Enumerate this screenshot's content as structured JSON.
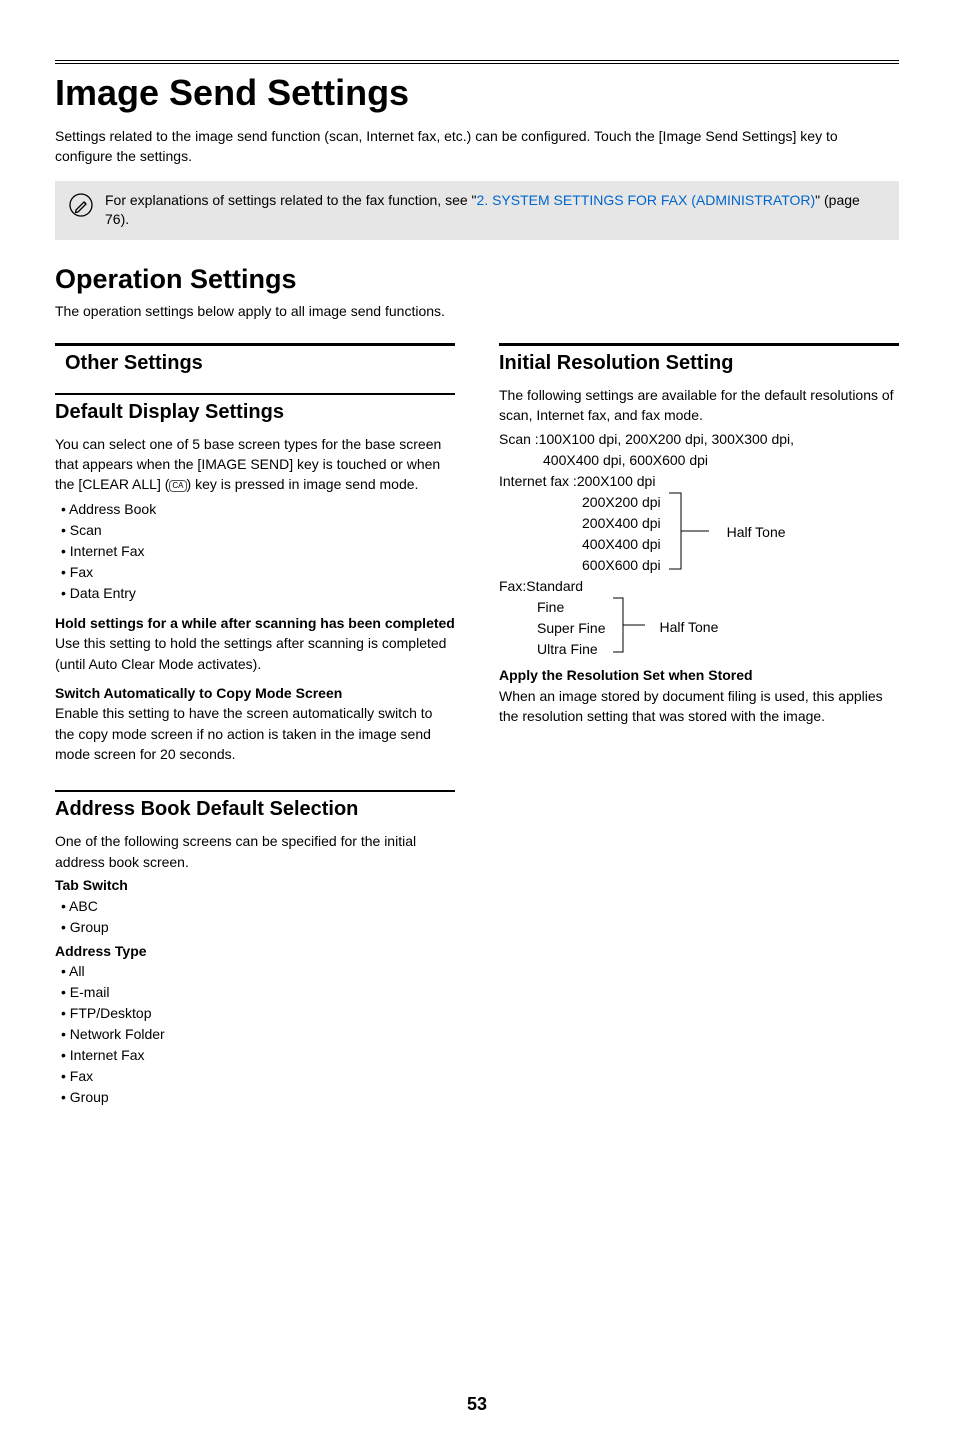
{
  "title": "Image Send Settings",
  "intro": "Settings related to the image send function (scan, Internet fax, etc.) can be configured. Touch the [Image Send Settings] key to configure the settings.",
  "note": {
    "prefix": "For explanations of settings related to the fax function, see \"",
    "link": "2. SYSTEM SETTINGS FOR FAX (ADMINISTRATOR)",
    "suffix": "\" (page 76)."
  },
  "h2": "Operation Settings",
  "h2_sub": "The operation settings below apply to all image send functions.",
  "left": {
    "other_settings": "Other Settings",
    "default_display": {
      "title": "Default Display Settings",
      "body_1": "You can select one of 5 base screen types for the base screen that appears when the [IMAGE SEND] key is touched or when the [CLEAR ALL] (",
      "body_2": ") key is pressed in image send mode.",
      "ca_label": "CA",
      "bullets": [
        "Address Book",
        "Scan",
        "Internet Fax",
        "Fax",
        "Data Entry"
      ],
      "hold_heading": "Hold settings for a while after scanning has been completed",
      "hold_body": "Use this setting to hold the settings after scanning is completed (until Auto Clear Mode activates).",
      "switch_heading": "Switch Automatically to Copy Mode Screen",
      "switch_body": "Enable this setting to have the screen automatically switch to the copy mode screen if no action is taken in the image send mode screen for 20 seconds."
    },
    "address_book": {
      "title": "Address Book Default Selection",
      "body": "One of the following screens can be specified for the initial address book screen.",
      "tab_switch_heading": "Tab Switch",
      "tab_switch_items": [
        "ABC",
        "Group"
      ],
      "address_type_heading": "Address Type",
      "address_type_items": [
        "All",
        "E-mail",
        "FTP/Desktop",
        "Network Folder",
        "Internet Fax",
        "Fax",
        "Group"
      ]
    }
  },
  "right": {
    "initial_resolution": {
      "title": "Initial Resolution Setting",
      "body": "The following settings are available for the default resolutions of scan, Internet fax, and fax mode.",
      "scan_label": "Scan :",
      "scan_line1": "100X100 dpi, 200X200 dpi, 300X300 dpi,",
      "scan_line2": "400X400 dpi, 600X600 dpi",
      "ifax_label": "Internet fax :",
      "ifax_items": [
        "200X100 dpi",
        "200X200 dpi",
        "200X400 dpi",
        "400X400 dpi",
        "600X600 dpi"
      ],
      "halftone": "Half Tone",
      "fax_label": "Fax:",
      "fax_items": [
        "Standard",
        "Fine",
        "Super Fine",
        "Ultra Fine"
      ],
      "apply_heading": "Apply the Resolution Set when Stored",
      "apply_body": "When an image stored by document filing is used, this applies the resolution setting that was stored with the image."
    }
  },
  "page_number": "53"
}
